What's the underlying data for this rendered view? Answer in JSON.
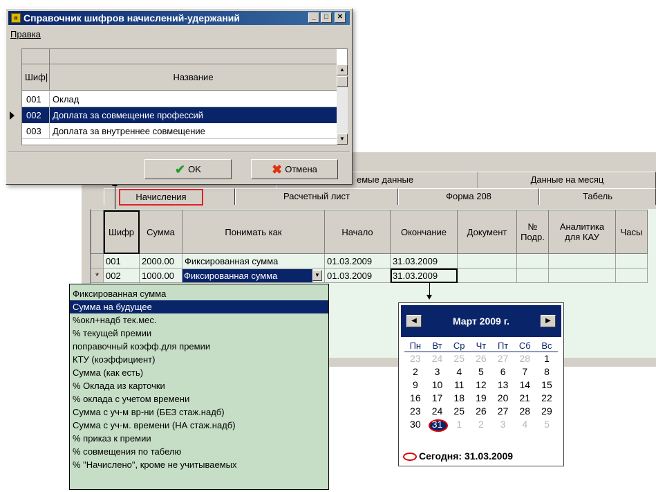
{
  "dialog": {
    "title": "Справочник шифров начислений-удержаний",
    "menu_label": "Правка",
    "col_code": "Шиф|",
    "col_name": "Название",
    "rows": [
      {
        "code": "001",
        "name": "Оклад"
      },
      {
        "code": "002",
        "name": "Доплата за совмещение профессий"
      },
      {
        "code": "003",
        "name": "Доплата за внутреннее совмещение"
      }
    ],
    "ok_label": "OK",
    "cancel_label": "Отмена"
  },
  "tabs_top": [
    "емые данные",
    "Данные на месяц"
  ],
  "tabs": [
    "Начисления",
    "Расчетный лист",
    "Форма 208",
    "Табель"
  ],
  "table": {
    "headers": [
      "Шифр",
      "Сумма",
      "Понимать как",
      "Начало",
      "Окончание",
      "Документ",
      "№ Подр.",
      "Аналитика для КАУ",
      "Часы"
    ],
    "rows": [
      {
        "marker": "",
        "code": "001",
        "amount": "2000.00",
        "kind": "Фиксированная сумма",
        "start": "01.03.2009",
        "end": "31.03.2009"
      },
      {
        "marker": "*",
        "code": "002",
        "amount": "1000.00",
        "kind": "Фиксированная сумма",
        "start": "01.03.2009",
        "end": "31.03.2009"
      }
    ]
  },
  "dropdown": {
    "items": [
      "Фиксированная сумма",
      "Сумма на будущее",
      "%окл+надб тек.мес.",
      "% текущей премии",
      "поправочный коэфф.для премии",
      "КТУ (коэффициент)",
      "Сумма (как есть)",
      "% Оклада из карточки",
      "% оклада с учетом времени",
      "Сумма с уч-м вр-ни (БЕЗ стаж.надб)",
      "Сумма с уч-м. времени (НА стаж.надб)",
      "% приказ к премии",
      "% совмещения по табелю",
      "% \"Начислено\", кроме не учитываемых"
    ],
    "selected_index": 1
  },
  "calendar": {
    "title": "Март 2009 г.",
    "weekdays": [
      "Пн",
      "Вт",
      "Ср",
      "Чт",
      "Пт",
      "Сб",
      "Вс"
    ],
    "weeks": [
      [
        "23",
        "24",
        "25",
        "26",
        "27",
        "28",
        "1"
      ],
      [
        "2",
        "3",
        "4",
        "5",
        "6",
        "7",
        "8"
      ],
      [
        "9",
        "10",
        "11",
        "12",
        "13",
        "14",
        "15"
      ],
      [
        "16",
        "17",
        "18",
        "19",
        "20",
        "21",
        "22"
      ],
      [
        "23",
        "24",
        "25",
        "26",
        "27",
        "28",
        "29"
      ],
      [
        "30",
        "31",
        "1",
        "2",
        "3",
        "4",
        "5"
      ]
    ],
    "today_label": "Сегодня: 31.03.2009"
  }
}
